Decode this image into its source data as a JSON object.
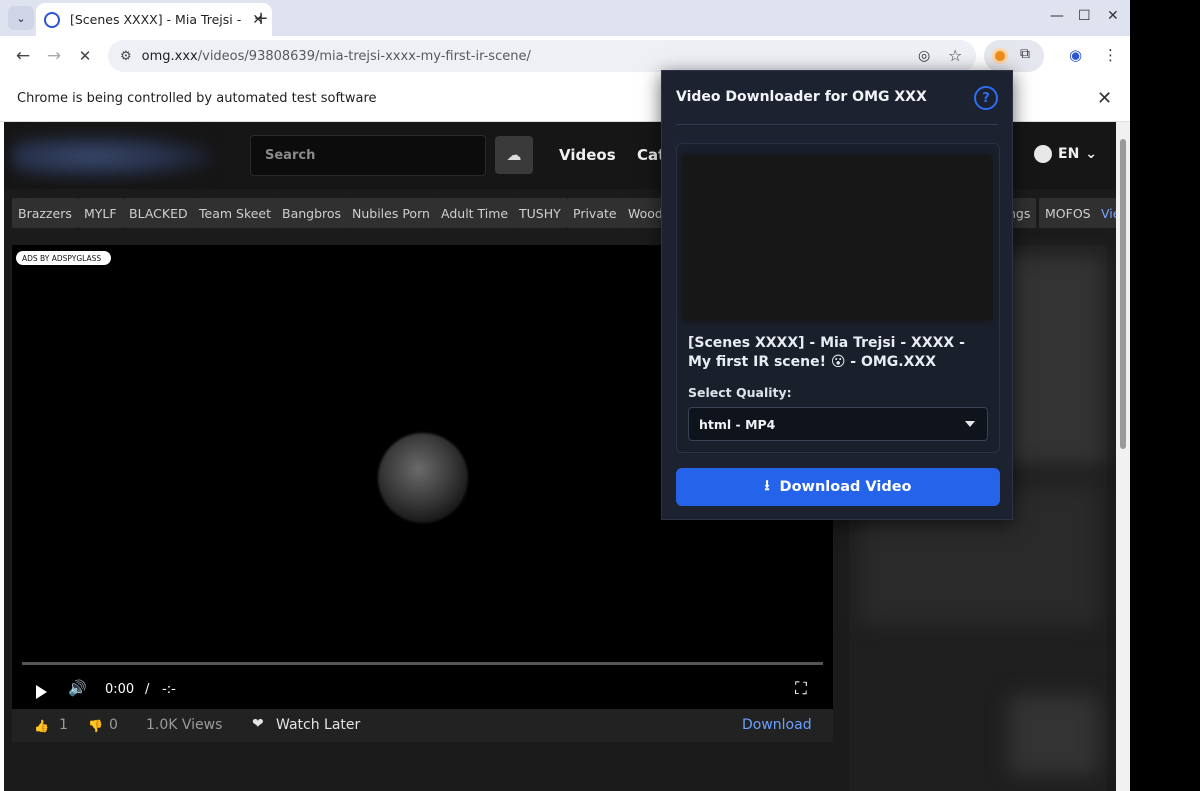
{
  "browser": {
    "tab_title": "[Scenes XXXX] - Mia Trejsi - XXXX - My first IR scene! 😮 - OMG.XXX",
    "tab_close": "✕",
    "new_tab": "+",
    "tab_menu": "⌄",
    "url_domain": "omg.xxx",
    "url_path": "/videos/93808639/mia-trejsi-xxxx-my-first-ir-scene/",
    "infobar_message": "Chrome is being controlled by automated test software",
    "infobar_close": "✕",
    "win_min": "—",
    "win_max": "☐",
    "win_close": "✕",
    "back": "←",
    "forward": "→",
    "reload": "✕",
    "site_icon": "⚙",
    "eye_icon": "◎",
    "star": "☆",
    "puzzle": "⧉",
    "profile": "◉",
    "menu": "⋮"
  },
  "site": {
    "search_placeholder": "Search",
    "upload_icon": "☁",
    "nav_videos": "Videos",
    "nav_cat": "Cat",
    "lang": "EN",
    "lang_caret": "⌄",
    "categories": [
      "Brazzers",
      "MYLF",
      "BLACKED",
      "Team Skeet",
      "Bangbros",
      "Nubiles Porn",
      "Adult Time",
      "TUSHY",
      "Private",
      "Wood"
    ],
    "categories_right": [
      "ngs",
      "MOFOS",
      "Vie"
    ]
  },
  "player": {
    "ads_badge": "ADS BY ADSPYGLASS",
    "time_current": "0:00",
    "time_sep": "/",
    "time_total": "-:-",
    "volume_icon": "🔊",
    "fullscreen_icon": "⛶"
  },
  "meta": {
    "likes": "1",
    "dislikes": "0",
    "views": "1.0K Views",
    "watch_later": "Watch Later",
    "download": "Download",
    "like_icon": "👍",
    "dislike_icon": "👎",
    "heart_icon": "❤"
  },
  "popup": {
    "title": "Video Downloader for OMG XXX",
    "help": "?",
    "video_title": "[Scenes XXXX] - Mia Trejsi - XXXX - My first IR scene! 😮 - OMG.XXX",
    "quality_label": "Select Quality:",
    "quality_value": "html - MP4",
    "download_button": "Download Video",
    "download_icon": "⭳"
  },
  "colors": {
    "accent_blue": "#2563eb",
    "link_blue": "#6c9fff",
    "popup_bg": "#1d2230"
  }
}
